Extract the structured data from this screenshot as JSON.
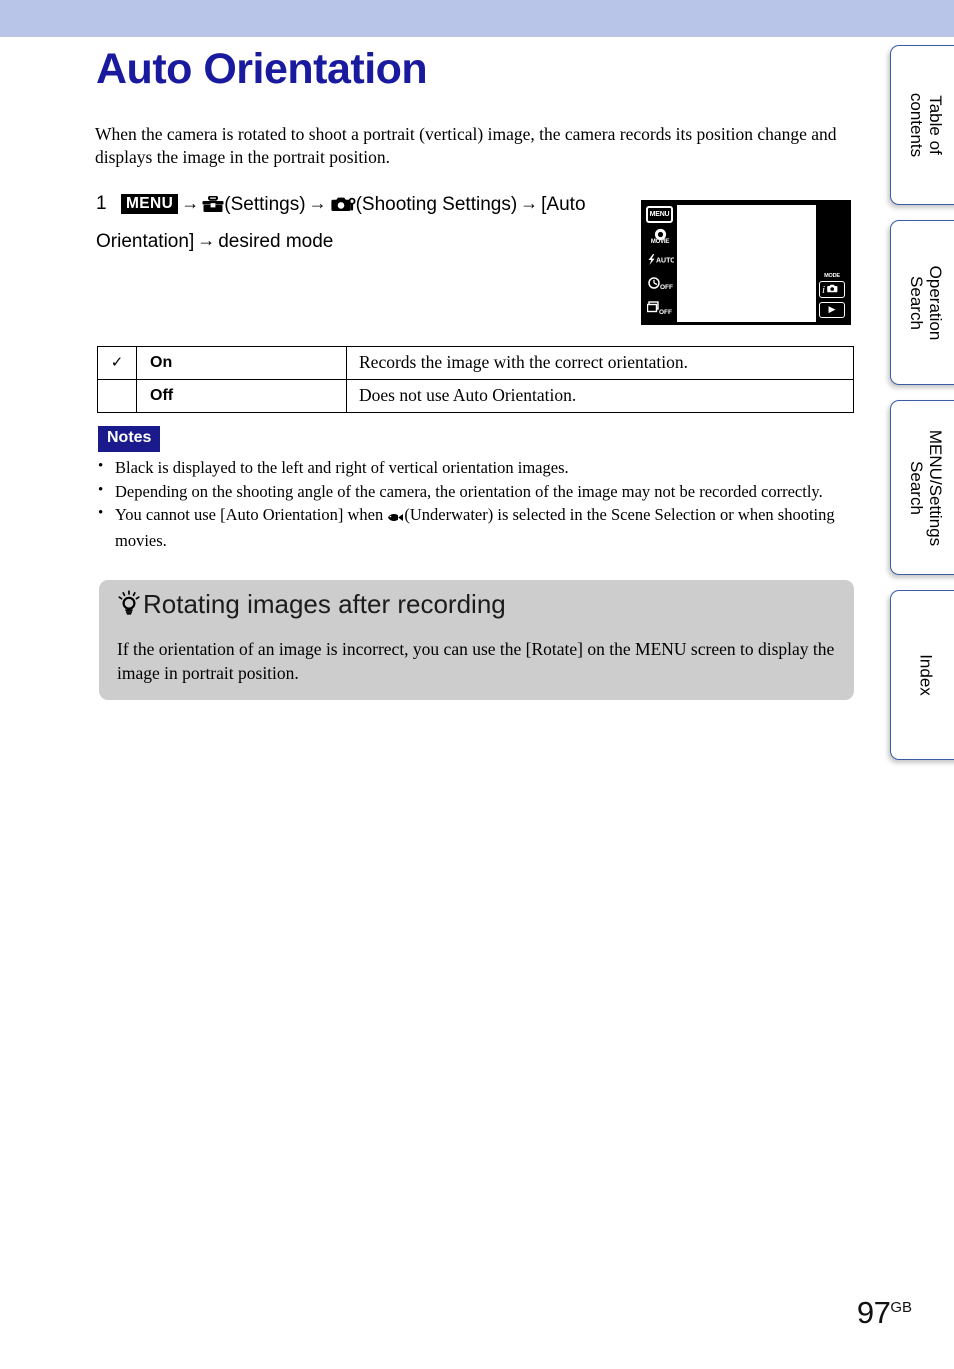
{
  "document": {
    "page_number": "97",
    "page_number_suffix": "GB",
    "title": "Auto Orientation",
    "intro": "When the camera is rotated to shoot a portrait (vertical) image, the camera records its position change and displays the image in the portrait position."
  },
  "step": {
    "number": "1",
    "menu_chip": "MENU",
    "arrow": "→",
    "settings_label": "(Settings)",
    "shooting_settings_label": "(Shooting Settings)",
    "item_label": "[Auto Orientation]",
    "result_label": "desired mode",
    "icons": {
      "settings": "toolbox-icon",
      "shooting_settings": "camera-wrench-icon"
    }
  },
  "lcd": {
    "menu_button": "MENU",
    "movie_label": "MOVIE",
    "flash_label": "AUTO",
    "timer_label": "OFF",
    "burst_label": "OFF",
    "mode_label": "MODE",
    "mode_button": "i",
    "play_button": "▶"
  },
  "options_table": {
    "rows": [
      {
        "checked": "✓",
        "name": "On",
        "description": "Records the image with the correct orientation."
      },
      {
        "checked": "",
        "name": "Off",
        "description": "Does not use Auto Orientation."
      }
    ]
  },
  "notes": {
    "badge": "Notes",
    "items": [
      "Black is displayed to the left and right of vertical orientation images.",
      "Depending on the shooting angle of the camera, the orientation of the image may not be recorded correctly.",
      "You cannot use [Auto Orientation] when"
    ],
    "item3_tail": "(Underwater) is selected in the Scene Selection or when shooting movies.",
    "underwater_icon": "fish-icon"
  },
  "tip": {
    "icon": "lightbulb-icon",
    "title": "Rotating images after recording",
    "body": "If the orientation of an image is incorrect, you can use the [Rotate] on the MENU screen to display the image in portrait position."
  },
  "tabs": [
    {
      "label": "Table of\ncontents",
      "line1": "Table of",
      "line2": "contents"
    },
    {
      "label": "Operation\nSearch",
      "line1": "Operation",
      "line2": "Search"
    },
    {
      "label": "MENU/Settings\nSearch",
      "line1": "MENU/Settings",
      "line2": "Search"
    },
    {
      "label": "Index",
      "line1": "Index",
      "line2": ""
    }
  ],
  "colors": {
    "header_band": "#b9c5e8",
    "title_blue": "#1a1a9e",
    "notes_badge": "#1a1a8c",
    "tip_box_gray": "#cdcdcd",
    "tab_border": "#3a5ca8"
  }
}
